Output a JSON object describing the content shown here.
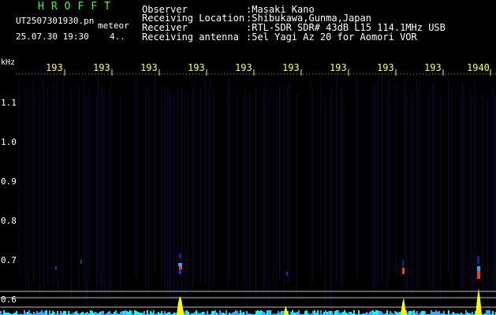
{
  "header": {
    "brand": "HROFFT",
    "filename": "UT2507301930.pn",
    "tag": "meteor",
    "datetime": "25.07.30 19:30",
    "count": "4.."
  },
  "info": [
    {
      "label": "Observer",
      "value": ":Masaki Kano"
    },
    {
      "label": "Receiving Location",
      "value": ":Shibukawa,Gunma,Japan"
    },
    {
      "label": "Receiver",
      "value": ":RTL-SDR SDR# 43dB L15 114.1MHz USB"
    },
    {
      "label": "Receiving antenna",
      "value": ":5el Yagi Az 20 for Aomori VOR"
    }
  ],
  "axes": {
    "y_unit": "kHz",
    "y_ticks": [
      "1.1",
      "1.0",
      "0.9",
      "0.8",
      "0.7",
      "0.6"
    ],
    "x_ticks": [
      "193",
      "193",
      "193",
      "193",
      "193",
      "193",
      "193",
      "193",
      "193",
      "1940"
    ]
  },
  "colors": {
    "background": "#000000",
    "tick_text": "#ffff33",
    "brand": "#33ff33",
    "signal_low": "#1a1aa0",
    "signal_high": "#ff3333",
    "spectrum": "#ffff00",
    "baseline": "#00ffff"
  }
}
